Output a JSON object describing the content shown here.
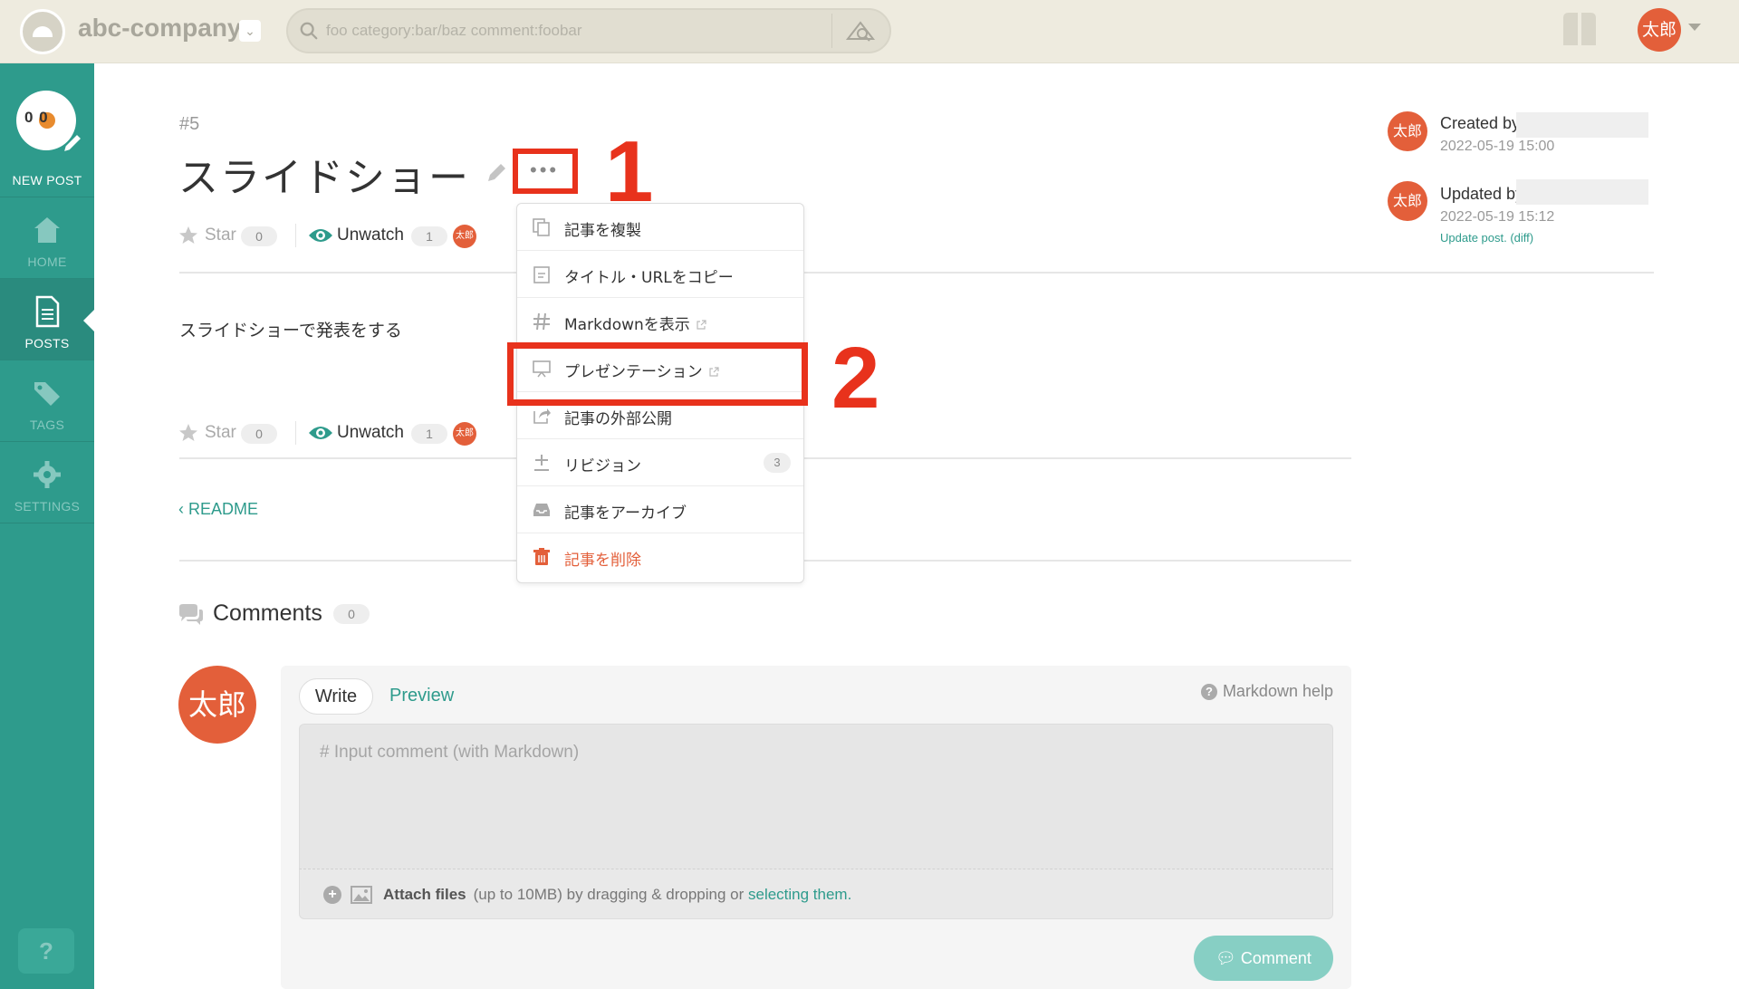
{
  "topbar": {
    "team_name": "abc-company",
    "search_placeholder": "foo category:bar/baz comment:foobar",
    "user_avatar_text": "太郎"
  },
  "sidebar": {
    "new_post_face": "0  0",
    "new_post_label": "NEW POST",
    "items": [
      {
        "label": "HOME",
        "icon": "home-icon"
      },
      {
        "label": "POSTS",
        "icon": "posts-icon"
      },
      {
        "label": "TAGS",
        "icon": "tags-icon"
      },
      {
        "label": "SETTINGS",
        "icon": "gear-icon"
      }
    ],
    "active": "POSTS",
    "help_label": "?"
  },
  "post": {
    "number": "#5",
    "title": "スライドショー",
    "more_dots": "•••",
    "body": "スライドショーで発表をする",
    "readme_link": "‹ README",
    "star_label": "Star",
    "star_count": "0",
    "unwatch_label": "Unwatch",
    "watch_count": "1",
    "watcher_avatar": "太郎"
  },
  "meta": {
    "created_label": "Created by",
    "created_date": "2022-05-19 15:00",
    "updated_label": "Updated by",
    "updated_date": "2022-05-19 15:12",
    "update_note": "Update post. (diff)",
    "avatar_text": "太郎"
  },
  "dropdown": {
    "items": [
      {
        "label": "記事を複製",
        "icon": "copy-icon"
      },
      {
        "label": "タイトル・URLをコピー",
        "icon": "clipboard-icon"
      },
      {
        "label": "Markdownを表示",
        "icon": "hash-icon",
        "external": true
      },
      {
        "label": "プレゼンテーション",
        "icon": "presentation-icon",
        "external": true
      },
      {
        "label": "記事の外部公開",
        "icon": "share-icon"
      },
      {
        "label": "リビジョン",
        "icon": "revision-icon",
        "badge": "3"
      },
      {
        "label": "記事をアーカイブ",
        "icon": "archive-icon"
      },
      {
        "label": "記事を削除",
        "icon": "trash-icon",
        "danger": true
      }
    ]
  },
  "annotations": {
    "step1": "1",
    "step2": "2",
    "color": "#e8321c"
  },
  "comments": {
    "title": "Comments",
    "count": "0",
    "avatar_text": "太郎",
    "write_tab": "Write",
    "preview_tab": "Preview",
    "markdown_help": "Markdown help",
    "input_placeholder": "# Input comment (with Markdown)",
    "attach_strong": "Attach files",
    "attach_text": "(up to 10MB) by dragging & dropping or ",
    "attach_link": "selecting them.",
    "submit_label": "Comment"
  },
  "colors": {
    "brand": "#2e9b8c",
    "avatar": "#e35f3a",
    "topbar": "#eeebdf"
  }
}
